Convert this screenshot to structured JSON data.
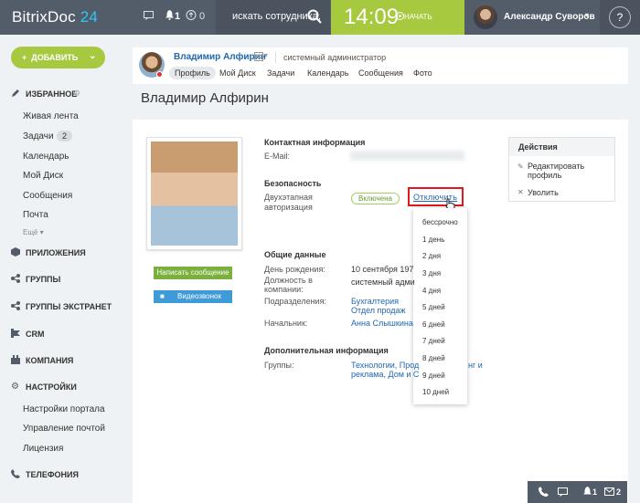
{
  "app": {
    "logo_main": "BitrixDoc",
    "logo_num": "24",
    "notif_count": "1",
    "chat_count": "0"
  },
  "header": {
    "search_placeholder": "искать сотрудника,",
    "time": "14:09",
    "start_label": "НАЧАТЬ",
    "user_name": "Александр Суворов",
    "help": "?"
  },
  "sidebar": {
    "add_label": "ДОБАВИТЬ",
    "favorites": "ИЗБРАННОЕ",
    "fav_items": [
      "Живая лента",
      "Задачи",
      "Календарь",
      "Мой Диск",
      "Сообщения",
      "Почта",
      "Ещё"
    ],
    "tasks_badge": "2",
    "sections": [
      "ПРИЛОЖЕНИЯ",
      "ГРУППЫ",
      "ГРУППЫ ЭКСТРАНЕТ",
      "CRM",
      "КОМПАНИЯ",
      "НАСТРОЙКИ"
    ],
    "settings_items": [
      "Настройки портала",
      "Управление почтой",
      "Лицензия"
    ],
    "telephony": "ТЕЛЕФОНИЯ"
  },
  "profile_card": {
    "name": "Владимир Алфирин",
    "role": "системный администратор",
    "tabs": [
      "Профиль",
      "Мой Диск",
      "Задачи",
      "Календарь",
      "Сообщения",
      "Фото"
    ]
  },
  "page_title": "Владимир Алфирин",
  "buttons": {
    "write": "Написать сообщение",
    "video": "Видеозвонок"
  },
  "contact": {
    "heading": "Контактная информация",
    "email_label": "E-Mail:"
  },
  "security": {
    "heading": "Безопасность",
    "twofa_label_1": "Двухэтапная",
    "twofa_label_2": "авторизация",
    "status": "Включена",
    "disable": "Отключить"
  },
  "duration_menu": [
    "бессрочно",
    "1 день",
    "2 дня",
    "3 дня",
    "4 дня",
    "5 дней",
    "6 дней",
    "7 дней",
    "8 дней",
    "9 дней",
    "10 дней"
  ],
  "general": {
    "heading": "Общие данные",
    "birthday_label": "День рождения:",
    "birthday": "10 сентября 197",
    "position_label_1": "Должность в",
    "position_label_2": "компании:",
    "position": "системный адми",
    "dept_label": "Подразделения:",
    "dept_1": "Бухгалтерия",
    "dept_2": "Отдел продаж",
    "boss_label": "Начальник:",
    "boss": "Анна Слышкина"
  },
  "extra": {
    "heading": "Дополнительная информация",
    "groups_label": "Группы:",
    "groups_1": "Технологии, Прод",
    "groups_1b": "нг и",
    "groups_2": "реклама, Дом и С"
  },
  "actions": {
    "heading": "Действия",
    "edit_1": "Редактировать",
    "edit_2": "профиль",
    "fire": "Уволить"
  },
  "bottom_bar": {
    "notif": "1",
    "mail": "2"
  }
}
